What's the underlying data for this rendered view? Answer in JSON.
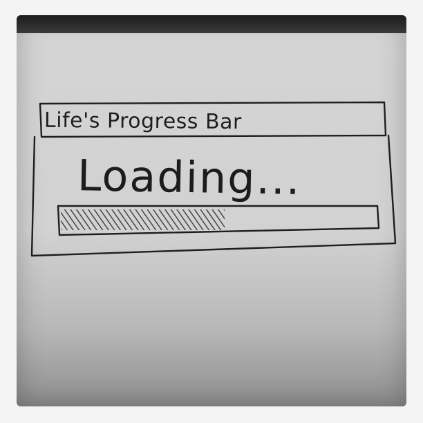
{
  "window": {
    "title": "Life's Progress Bar"
  },
  "status": {
    "text": "Loading..."
  },
  "progress": {
    "fraction": 0.52
  },
  "colors": {
    "ink": "#1e1e1e",
    "paper": "#d3d3d3",
    "top_strip": "#2a2a2a"
  }
}
